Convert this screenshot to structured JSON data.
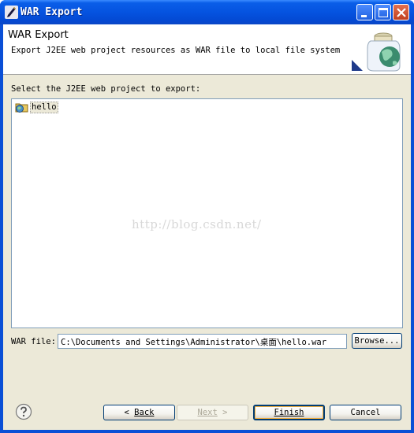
{
  "window": {
    "title": "WAR Export",
    "icon": "eclipse-pen-icon"
  },
  "banner": {
    "title": "WAR Export",
    "description": "Export J2EE web project resources as WAR file to local file system",
    "graphic": "war-globe-jar-icon"
  },
  "project_list": {
    "label": "Select the J2EE web project to export:",
    "items": [
      {
        "label": "hello",
        "icon": "web-project-icon"
      }
    ]
  },
  "watermark": "http://blog.csdn.net/",
  "war_file": {
    "label": "WAR file:",
    "value": "C:\\Documents and Settings\\Administrator\\桌面\\hello.war",
    "browse_label": "Browse..."
  },
  "footer": {
    "help_icon": "help-icon",
    "back_arrow": "<",
    "back_text": "Back",
    "next_text": "Next",
    "next_arrow": ">",
    "finish_text": "Finish",
    "cancel_text": "Cancel"
  },
  "colors": {
    "titlebar": "#0553e0",
    "dialog_bg": "#ece9d8",
    "input_border": "#7f9db9"
  }
}
